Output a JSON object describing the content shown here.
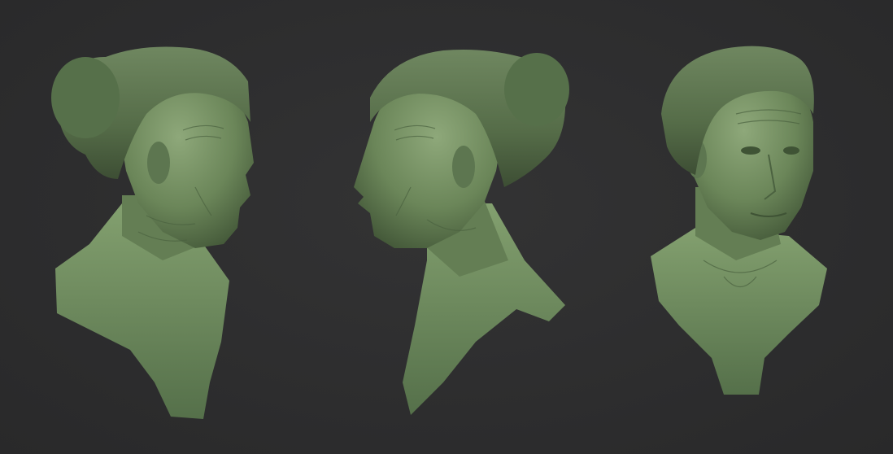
{
  "scene": {
    "background_color": "#2d2d2e",
    "material_color": "#6f8a5e",
    "material_shadow": "#3e5234",
    "material_highlight": "#93ab7f",
    "busts": [
      {
        "view": "right-profile",
        "facing": "right"
      },
      {
        "view": "left-profile",
        "facing": "left"
      },
      {
        "view": "three-quarter",
        "facing": "front-right"
      }
    ]
  }
}
